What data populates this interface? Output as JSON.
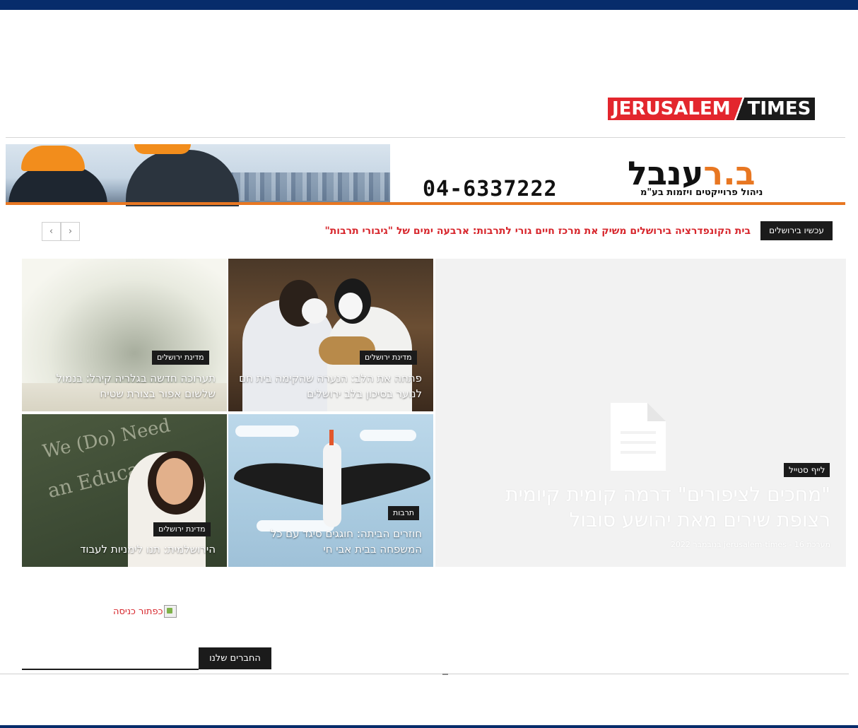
{
  "colors": {
    "brand_navy": "#072c6b",
    "accent_red": "#d7262c",
    "label_black": "#1b1b1b",
    "banner_orange": "#e87722"
  },
  "logo": {
    "left": "JERUSALEM",
    "right": "TIMES"
  },
  "banner": {
    "phone": "04-6337222",
    "brand_a": "ב",
    "brand_b": ".ר",
    "brand_c": "ענבל",
    "subtitle": "ניהול פרוייקטים ויזמות בע\"מ"
  },
  "ticker": {
    "label": "עכשיו בירושלים",
    "text": "בית הקונפדרציה בירושלים משיק את מרכז חיים גורי לתרבות: ארבעה ימים של \"גיבורי תרבות\"",
    "prev_icon": "chevron-left-icon",
    "next_icon": "chevron-right-icon",
    "prev_glyph": "‹",
    "next_glyph": "›"
  },
  "featured": {
    "category": "לייף סטייל",
    "title": "\"מחכים לציפורים\" דרמה קומית קיומית רצופת שירים מאת יהושע סובול",
    "meta": "מערכת jerusalem-times - 16 בנובמבר 2022",
    "icon": "document-icon"
  },
  "tiles": [
    {
      "category": "מדינת ירושלים",
      "title": "תערוכה חדשה בגלריה קירל: בנמול שלשום אפור בצורת שטיח"
    },
    {
      "category": "מדינת ירושלים",
      "title": "פתחה את הלב: הנערה שהקימה בית חם לנוער בסיכון בלב ירושלים"
    },
    {
      "category": "מדינת ירושלים",
      "title": "הירושלמית: תנו לימניות לעבוד",
      "chalk_1": "We (Do) Need",
      "chalk_2": "an Education"
    },
    {
      "category": "תרבות",
      "title": "חוזרים הביתה: חוגגים סיגד עם כל המשפחה בבית אבי חי"
    }
  ],
  "login": {
    "alt_text": "כפתור כניסה"
  },
  "friends": {
    "label": "החברים שלנו"
  }
}
